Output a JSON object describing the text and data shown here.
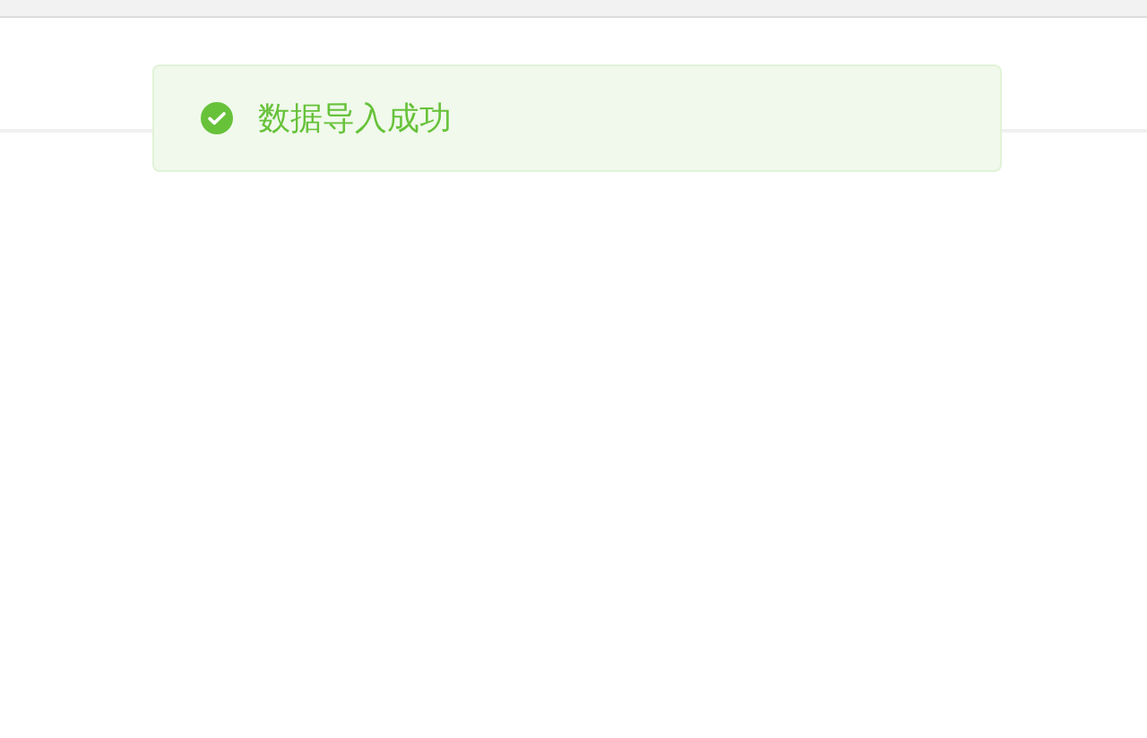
{
  "message": {
    "kind": "success",
    "text": "数据导入成功"
  }
}
